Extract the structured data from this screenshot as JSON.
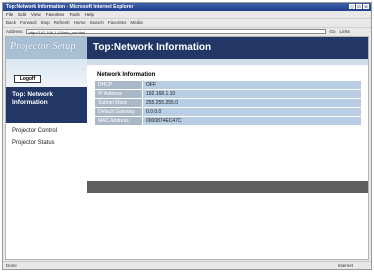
{
  "browser": {
    "title": "Top:Network Information - Microsoft Internet Explorer",
    "menu": [
      "File",
      "Edit",
      "View",
      "Favorites",
      "Tools",
      "Help"
    ],
    "toolbar": [
      "Back",
      "Forward",
      "Stop",
      "Refresh",
      "Home",
      "Search",
      "Favorites",
      "Media"
    ],
    "address_label": "Address",
    "address": "http://192.168.1.10/info_nw.html",
    "go_label": "Go",
    "links_label": "Links",
    "status_left": "Done",
    "status_right": "Internet"
  },
  "sidebar": {
    "logo": "Projector Setup",
    "logout_label": "Logoff",
    "active_item": "Top: Network Information",
    "items": [
      "Projector Control",
      "Projector Status"
    ]
  },
  "main": {
    "header": "Top:Network Information",
    "section_title": "Network Information",
    "rows": [
      {
        "key": "DHCP",
        "value": "OFF"
      },
      {
        "key": "IP Address",
        "value": "192.168.1.10"
      },
      {
        "key": "Subnet Mask",
        "value": "255.255.255.0"
      },
      {
        "key": "Default Gateway",
        "value": "0.0.0.0"
      },
      {
        "key": "MAC Address",
        "value": "0000874EC47C"
      }
    ]
  }
}
